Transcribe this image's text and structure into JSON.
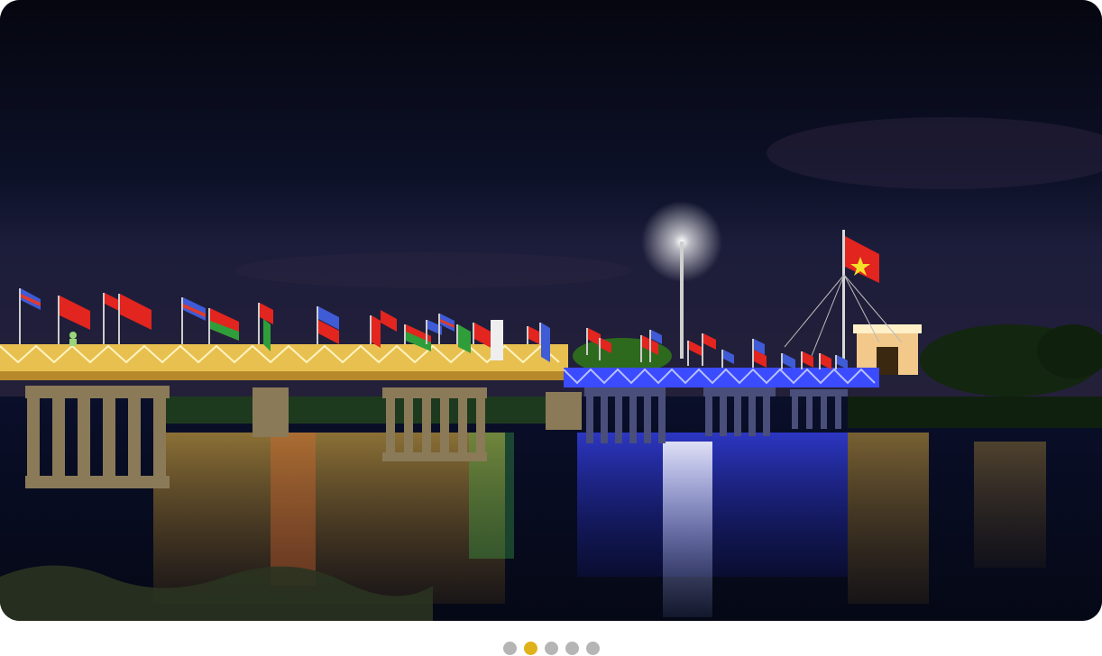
{
  "carousel": {
    "total_slides": 5,
    "active_index": 1,
    "slide_image": {
      "icon": "night-bridge-photo"
    },
    "colors": {
      "active_dot": "#e0b21a",
      "inactive_dot": "#b5b5b5"
    }
  }
}
